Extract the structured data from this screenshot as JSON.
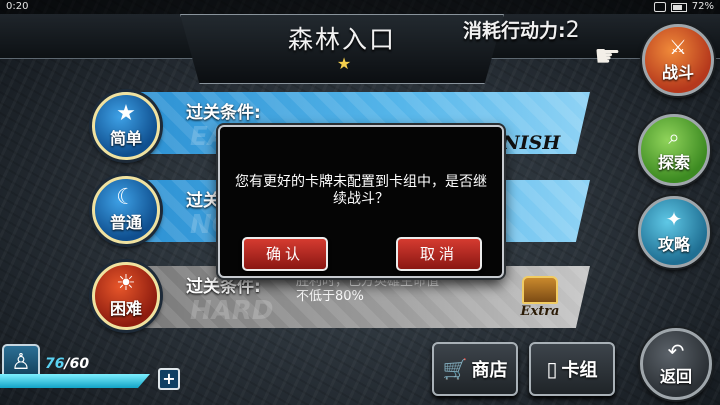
{
  "status_bar": {
    "time": "0:20",
    "battery": "72%"
  },
  "header": {
    "title": "森林入口",
    "star_icon": "star-icon",
    "cost_label": "消耗行动力:",
    "cost_value": "2"
  },
  "right_buttons": [
    {
      "label": "战斗",
      "icon": "crossed-swords-icon"
    },
    {
      "label": "探索",
      "icon": "telescope-icon"
    },
    {
      "label": "攻略",
      "icon": "lightbulb-icon"
    },
    {
      "label": "返回",
      "icon": "return-arrow-icon"
    }
  ],
  "difficulties": [
    {
      "label": "简单",
      "icon": "star-icon",
      "watermark": "EASY",
      "condition_label": "过关条件:",
      "reward": "FINISH"
    },
    {
      "label": "普通",
      "icon": "moon-icon",
      "watermark": "NORMAL",
      "condition_label": "过关条件:"
    },
    {
      "label": "困难",
      "icon": "sun-icon",
      "watermark": "HARD",
      "condition_label": "过关条件:",
      "condition_text": "胜利时，己方英雄生命值不低于80%",
      "reward": "Extra"
    }
  ],
  "dialog": {
    "message": "您有更好的卡牌未配置到卡组中，是否继续战斗？",
    "confirm_label": "确认",
    "cancel_label": "取消"
  },
  "energy": {
    "current": "76",
    "max": "/60",
    "icon": "walking-person-icon"
  },
  "bottom_buttons": {
    "shop_label": "商店",
    "deck_label": "卡组"
  },
  "colors": {
    "bar_blue": "#3aa4e3",
    "bar_gray": "#9c9c9c",
    "dialog_button": "#c2312a",
    "energy": "#5bd2f2"
  }
}
